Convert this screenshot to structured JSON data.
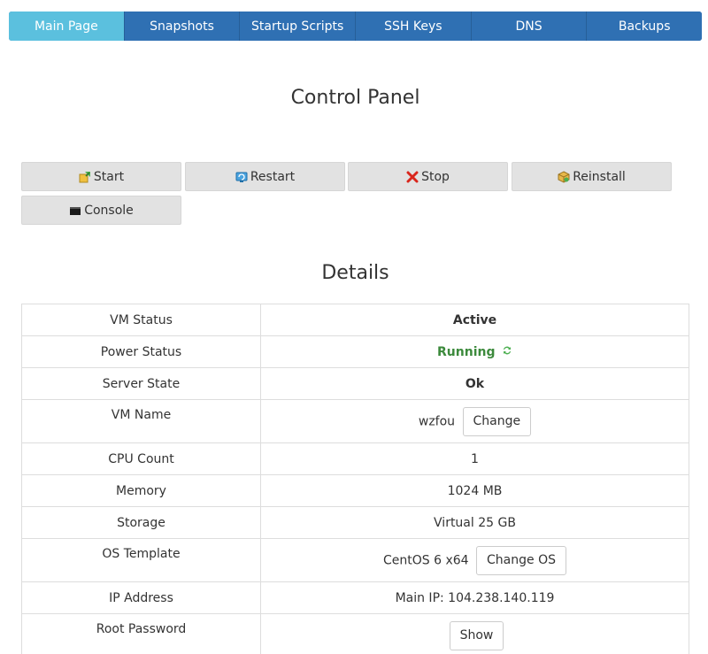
{
  "tabs": [
    {
      "label": "Main Page",
      "active": true
    },
    {
      "label": "Snapshots"
    },
    {
      "label": "Startup Scripts"
    },
    {
      "label": "SSH Keys"
    },
    {
      "label": "DNS"
    },
    {
      "label": "Backups"
    }
  ],
  "control_panel": {
    "title": "Control Panel",
    "buttons": {
      "start": {
        "label": "Start",
        "icon": "start-icon"
      },
      "restart": {
        "label": "Restart",
        "icon": "restart-icon"
      },
      "stop": {
        "label": "Stop",
        "icon": "stop-icon"
      },
      "reinstall": {
        "label": "Reinstall",
        "icon": "reinstall-icon"
      },
      "console": {
        "label": "Console",
        "icon": "console-icon"
      }
    }
  },
  "details": {
    "title": "Details",
    "vm_status": {
      "label": "VM Status",
      "value": "Active"
    },
    "power_status": {
      "label": "Power Status",
      "value": "Running",
      "color": "#3c8a3c"
    },
    "server_state": {
      "label": "Server State",
      "value": "Ok"
    },
    "vm_name": {
      "label": "VM Name",
      "value": "wzfou",
      "button": "Change"
    },
    "cpu_count": {
      "label": "CPU Count",
      "value": "1"
    },
    "memory": {
      "label": "Memory",
      "value": "1024 MB"
    },
    "storage": {
      "label": "Storage",
      "value": "Virtual 25 GB"
    },
    "os_template": {
      "label": "OS Template",
      "value": "CentOS 6 x64",
      "button": "Change OS"
    },
    "ip_address": {
      "label": "IP Address",
      "value": "Main IP: 104.238.140.119"
    },
    "root_password": {
      "label": "Root Password",
      "button": "Show"
    }
  },
  "colors": {
    "tab_bar": "#2f70b3",
    "tab_active": "#5bc0de",
    "button_bg": "#e2e2e2"
  }
}
